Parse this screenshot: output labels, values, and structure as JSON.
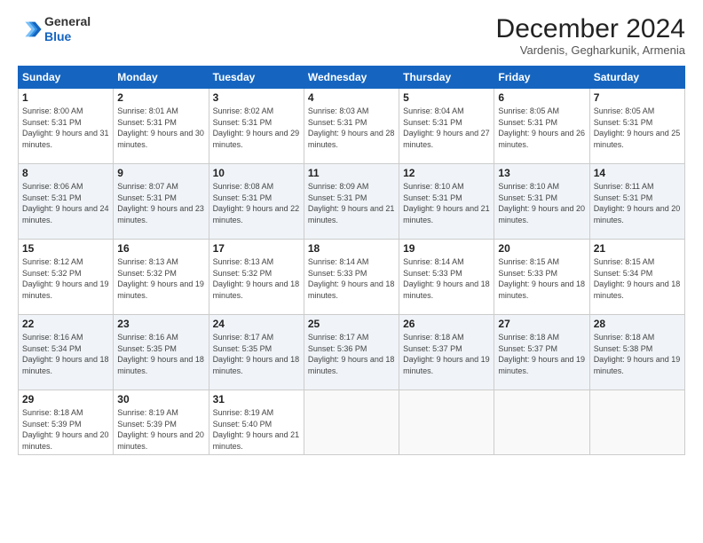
{
  "header": {
    "logo_line1": "General",
    "logo_line2": "Blue",
    "month": "December 2024",
    "location": "Vardenis, Gegharkunik, Armenia"
  },
  "weekdays": [
    "Sunday",
    "Monday",
    "Tuesday",
    "Wednesday",
    "Thursday",
    "Friday",
    "Saturday"
  ],
  "weeks": [
    [
      {
        "day": "1",
        "sunrise": "8:00 AM",
        "sunset": "5:31 PM",
        "daylight": "9 hours and 31 minutes."
      },
      {
        "day": "2",
        "sunrise": "8:01 AM",
        "sunset": "5:31 PM",
        "daylight": "9 hours and 30 minutes."
      },
      {
        "day": "3",
        "sunrise": "8:02 AM",
        "sunset": "5:31 PM",
        "daylight": "9 hours and 29 minutes."
      },
      {
        "day": "4",
        "sunrise": "8:03 AM",
        "sunset": "5:31 PM",
        "daylight": "9 hours and 28 minutes."
      },
      {
        "day": "5",
        "sunrise": "8:04 AM",
        "sunset": "5:31 PM",
        "daylight": "9 hours and 27 minutes."
      },
      {
        "day": "6",
        "sunrise": "8:05 AM",
        "sunset": "5:31 PM",
        "daylight": "9 hours and 26 minutes."
      },
      {
        "day": "7",
        "sunrise": "8:05 AM",
        "sunset": "5:31 PM",
        "daylight": "9 hours and 25 minutes."
      }
    ],
    [
      {
        "day": "8",
        "sunrise": "8:06 AM",
        "sunset": "5:31 PM",
        "daylight": "9 hours and 24 minutes."
      },
      {
        "day": "9",
        "sunrise": "8:07 AM",
        "sunset": "5:31 PM",
        "daylight": "9 hours and 23 minutes."
      },
      {
        "day": "10",
        "sunrise": "8:08 AM",
        "sunset": "5:31 PM",
        "daylight": "9 hours and 22 minutes."
      },
      {
        "day": "11",
        "sunrise": "8:09 AM",
        "sunset": "5:31 PM",
        "daylight": "9 hours and 21 minutes."
      },
      {
        "day": "12",
        "sunrise": "8:10 AM",
        "sunset": "5:31 PM",
        "daylight": "9 hours and 21 minutes."
      },
      {
        "day": "13",
        "sunrise": "8:10 AM",
        "sunset": "5:31 PM",
        "daylight": "9 hours and 20 minutes."
      },
      {
        "day": "14",
        "sunrise": "8:11 AM",
        "sunset": "5:31 PM",
        "daylight": "9 hours and 20 minutes."
      }
    ],
    [
      {
        "day": "15",
        "sunrise": "8:12 AM",
        "sunset": "5:32 PM",
        "daylight": "9 hours and 19 minutes."
      },
      {
        "day": "16",
        "sunrise": "8:13 AM",
        "sunset": "5:32 PM",
        "daylight": "9 hours and 19 minutes."
      },
      {
        "day": "17",
        "sunrise": "8:13 AM",
        "sunset": "5:32 PM",
        "daylight": "9 hours and 18 minutes."
      },
      {
        "day": "18",
        "sunrise": "8:14 AM",
        "sunset": "5:33 PM",
        "daylight": "9 hours and 18 minutes."
      },
      {
        "day": "19",
        "sunrise": "8:14 AM",
        "sunset": "5:33 PM",
        "daylight": "9 hours and 18 minutes."
      },
      {
        "day": "20",
        "sunrise": "8:15 AM",
        "sunset": "5:33 PM",
        "daylight": "9 hours and 18 minutes."
      },
      {
        "day": "21",
        "sunrise": "8:15 AM",
        "sunset": "5:34 PM",
        "daylight": "9 hours and 18 minutes."
      }
    ],
    [
      {
        "day": "22",
        "sunrise": "8:16 AM",
        "sunset": "5:34 PM",
        "daylight": "9 hours and 18 minutes."
      },
      {
        "day": "23",
        "sunrise": "8:16 AM",
        "sunset": "5:35 PM",
        "daylight": "9 hours and 18 minutes."
      },
      {
        "day": "24",
        "sunrise": "8:17 AM",
        "sunset": "5:35 PM",
        "daylight": "9 hours and 18 minutes."
      },
      {
        "day": "25",
        "sunrise": "8:17 AM",
        "sunset": "5:36 PM",
        "daylight": "9 hours and 18 minutes."
      },
      {
        "day": "26",
        "sunrise": "8:18 AM",
        "sunset": "5:37 PM",
        "daylight": "9 hours and 19 minutes."
      },
      {
        "day": "27",
        "sunrise": "8:18 AM",
        "sunset": "5:37 PM",
        "daylight": "9 hours and 19 minutes."
      },
      {
        "day": "28",
        "sunrise": "8:18 AM",
        "sunset": "5:38 PM",
        "daylight": "9 hours and 19 minutes."
      }
    ],
    [
      {
        "day": "29",
        "sunrise": "8:18 AM",
        "sunset": "5:39 PM",
        "daylight": "9 hours and 20 minutes."
      },
      {
        "day": "30",
        "sunrise": "8:19 AM",
        "sunset": "5:39 PM",
        "daylight": "9 hours and 20 minutes."
      },
      {
        "day": "31",
        "sunrise": "8:19 AM",
        "sunset": "5:40 PM",
        "daylight": "9 hours and 21 minutes."
      },
      null,
      null,
      null,
      null
    ]
  ]
}
